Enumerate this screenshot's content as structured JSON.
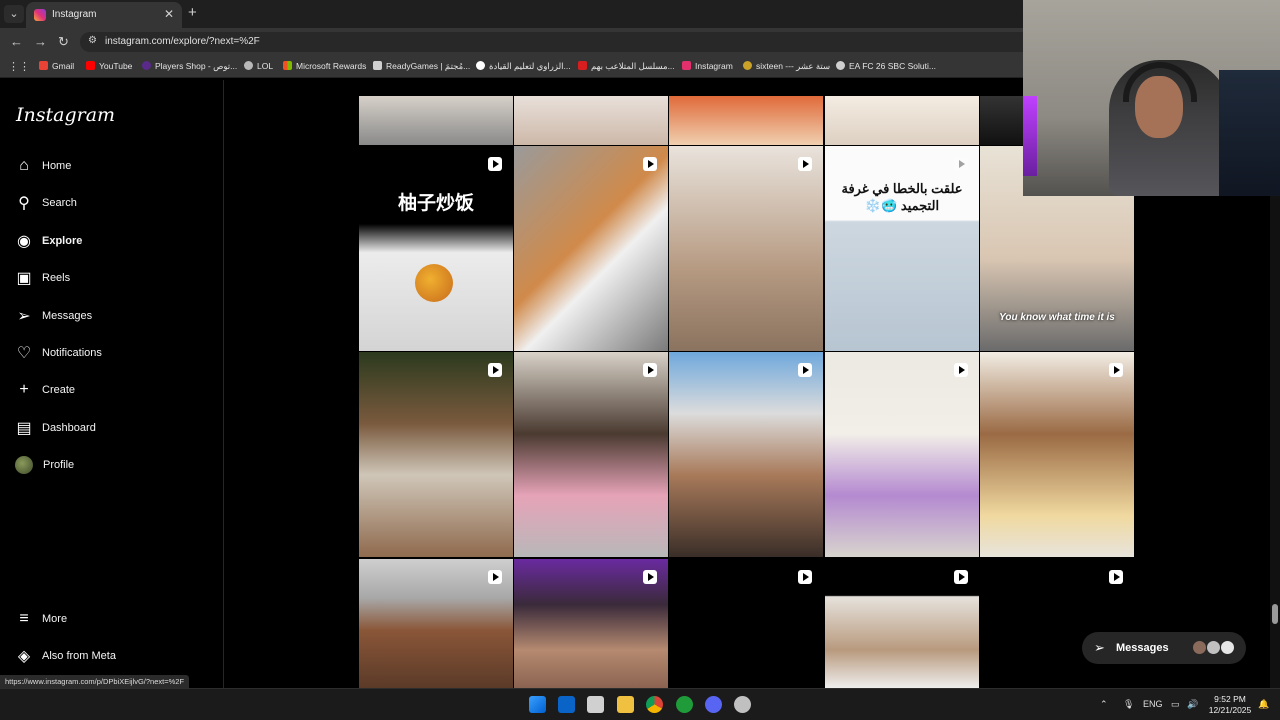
{
  "browser": {
    "tab_title": "Instagram",
    "url": "instagram.com/explore/?next=%2F",
    "bookmarks": [
      {
        "label": "Gmail",
        "color": "#ea4335"
      },
      {
        "label": "YouTube",
        "color": "#ff0000"
      },
      {
        "label": "Players Shop - توص...",
        "color": "#5a2a8a"
      },
      {
        "label": "LOL",
        "color": "#b8b8b8"
      },
      {
        "label": "Microsoft Rewards",
        "color": "#00a4ef"
      },
      {
        "label": "ReadyGames | مُجتمَ...",
        "color": "#cfcfcf"
      },
      {
        "label": "الزراوي لتعليم القيادة...",
        "color": "#ffffff"
      },
      {
        "label": "مسلسل المتلاعب بهم...",
        "color": "#d81e1e"
      },
      {
        "label": "Instagram",
        "color": "#e1306c"
      },
      {
        "label": "sixteen --- ستة عشر",
        "color": "#c9a227"
      },
      {
        "label": "EA FC 26 SBC Soluti...",
        "color": "#d0d0d0"
      }
    ]
  },
  "sidebar": {
    "logo": "Instagram",
    "items": [
      {
        "label": "Home",
        "icon": "home-icon",
        "glyph": "⌂"
      },
      {
        "label": "Search",
        "icon": "search-icon",
        "glyph": "⚲"
      },
      {
        "label": "Explore",
        "icon": "compass-icon",
        "glyph": "◉"
      },
      {
        "label": "Reels",
        "icon": "reels-icon",
        "glyph": "▣"
      },
      {
        "label": "Messages",
        "icon": "messenger-icon",
        "glyph": "➢"
      },
      {
        "label": "Notifications",
        "icon": "heart-icon",
        "glyph": "♡"
      },
      {
        "label": "Create",
        "icon": "plus-icon",
        "glyph": "+"
      },
      {
        "label": "Dashboard",
        "icon": "dashboard-icon",
        "glyph": "▤"
      },
      {
        "label": "Profile",
        "icon": "avatar"
      }
    ],
    "bottom_items": [
      {
        "label": "More",
        "icon": "menu-icon",
        "glyph": "≡"
      },
      {
        "label": "Also from Meta",
        "icon": "meta-icon",
        "glyph": "◈"
      }
    ],
    "active": "Explore"
  },
  "grid": {
    "tiles": [
      {
        "caption": "柚子炒饭",
        "reel": true,
        "bg": "linear-gradient(180deg,#000 0%,#000 40%,#e8e8e8 60%,#d4d4d4 100%)"
      },
      {
        "caption": "",
        "reel": true,
        "bg": "linear-gradient(135deg,#9a9a9a 0%,#d08a4a 45%,#f0f0f0 60%,#7a7a7a 100%)"
      },
      {
        "caption": "",
        "reel": true,
        "bg": "linear-gradient(180deg,#e9e3dc 0%,#b69a82 60%,#8a735f 100%)"
      },
      {
        "caption": "علقت بالخطا في غرفة التجميد 🥶❄️",
        "reel": true,
        "bg": "linear-gradient(180deg,#fbfbfb 0%,#fbfbfb 35%,#cdd7df 36%,#b7c5d2 100%)"
      },
      {
        "caption": "You know what time it is",
        "reel": false,
        "bg": "linear-gradient(180deg,#e8e2d6 0%,#d9c6b2 50%,#6b6b6b 100%)"
      },
      {
        "caption": "",
        "reel": true,
        "bg": "linear-gradient(180deg,#2c3a1e 0%,#7a5a3e 35%,#cfc6b8 60%,#8f6a4e 100%)"
      },
      {
        "caption": "",
        "reel": true,
        "bg": "linear-gradient(180deg,#d8d2c8 0%,#4a3a30 40%,#e6a3b8 70%,#b8b8b8 100%)"
      },
      {
        "caption": "",
        "reel": true,
        "bg": "linear-gradient(180deg,#6fa8dc 0%,#dcdcdc 30%,#a87a5a 60%,#3a2e28 100%)"
      },
      {
        "caption": "",
        "reel": true,
        "bg": "linear-gradient(180deg,#ece8e2 0%,#f2eee8 40%,#b48ad0 70%,#d8d4ce 100%)"
      },
      {
        "caption": "",
        "reel": true,
        "bg": "linear-gradient(180deg,#f2ede4 0%,#9a6a44 40%,#f0d9a0 80%,#e8e4dc 100%)"
      },
      {
        "caption": "",
        "reel": true,
        "bg": "linear-gradient(180deg,#cfcfcf 0%,#a8a8a8 30%,#8a5638 55%,#5a3a28 100%)"
      },
      {
        "caption": "",
        "reel": true,
        "bg": "linear-gradient(180deg,#6a2aa0 0%,#3a2a3a 35%,#b58a70 70%,#8a6250 100%)"
      },
      {
        "caption": "",
        "reel": true,
        "bg": "#000000"
      },
      {
        "caption": "",
        "reel": true,
        "bg": "linear-gradient(180deg,#000 0%,#000 20%,#e6e2dc 21%,#b89a7e 70%,#f0f0f0 100%)"
      },
      {
        "caption": "",
        "reel": true,
        "bg": "#000000"
      }
    ],
    "top_strip": [
      "linear-gradient(180deg,#d6d0c8,#8a8a8a)",
      "linear-gradient(180deg,#e8e0da,#cdb8a8)",
      "linear-gradient(180deg,#e06a3a,#f0d0b0)",
      "linear-gradient(180deg,#f4ece2,#ddd0c2)",
      "linear-gradient(180deg,#333,#111)"
    ]
  },
  "messages_pill": {
    "label": "Messages"
  },
  "status_url": "https://www.instagram.com/p/DPbiXEijlvG/?next=%2F",
  "taskbar": {
    "lang": "ENG",
    "time": "9:52 PM",
    "date": "12/21/2025"
  }
}
